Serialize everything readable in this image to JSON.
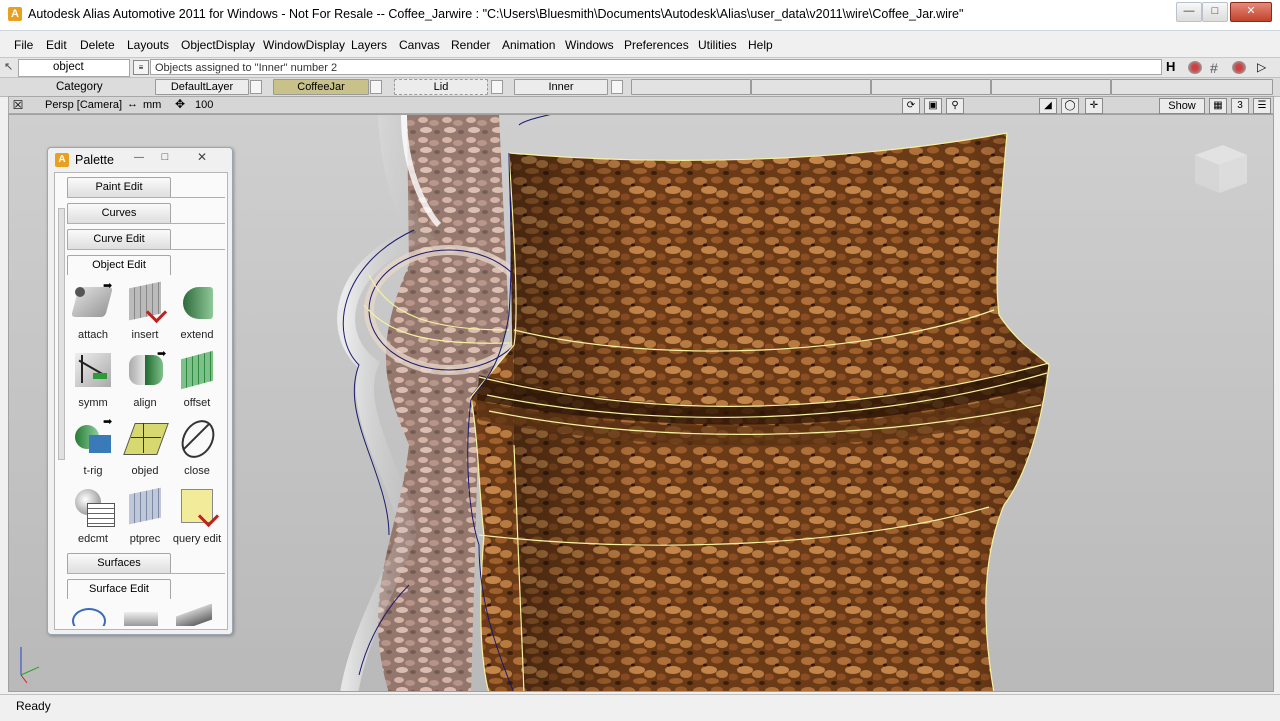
{
  "window": {
    "title": "Autodesk Alias Automotive 2011  for Windows - Not For Resale  --  Coffee_Jarwire : \"C:\\Users\\Bluesmith\\Documents\\Autodesk\\Alias\\user_data\\v2011\\wire\\Coffee_Jar.wire\""
  },
  "menu": [
    "File",
    "Edit",
    "Delete",
    "Layouts",
    "ObjectDisplay",
    "WindowDisplay",
    "Layers",
    "Canvas",
    "Render",
    "Animation",
    "Windows",
    "Preferences",
    "Utilities",
    "Help"
  ],
  "control_bar": {
    "pick_mode": "object",
    "prompt": "Objects assigned to \"Inner\" number 2"
  },
  "layer_bar": {
    "category_label": "Category",
    "layers": [
      "DefaultLayer",
      "CoffeeJar",
      "Lid",
      "Inner"
    ],
    "active_layer": "CoffeeJar",
    "active_color": "#c8c28a"
  },
  "viewport": {
    "camera_label": "Persp [Camera]",
    "units": "mm",
    "scale_value": "100",
    "show_button": "Show",
    "layout_number": "3"
  },
  "palette": {
    "title": "Palette",
    "tabs": [
      "Paint Edit",
      "Curves",
      "Curve Edit",
      "Object Edit"
    ],
    "tools": [
      "attach",
      "insert",
      "extend",
      "symm",
      "align",
      "offset",
      "t-rig",
      "objed",
      "close",
      "edcmt",
      "ptprec",
      "query edit"
    ],
    "bottom_tabs": [
      "Surfaces",
      "Surface Edit"
    ]
  },
  "status": {
    "text": "Ready"
  },
  "colors": {
    "accent": "#c8c28a",
    "window_bg": "#f0f0f0",
    "viewport_bg": "#c4c4c4",
    "coffee": "#7a4520"
  }
}
